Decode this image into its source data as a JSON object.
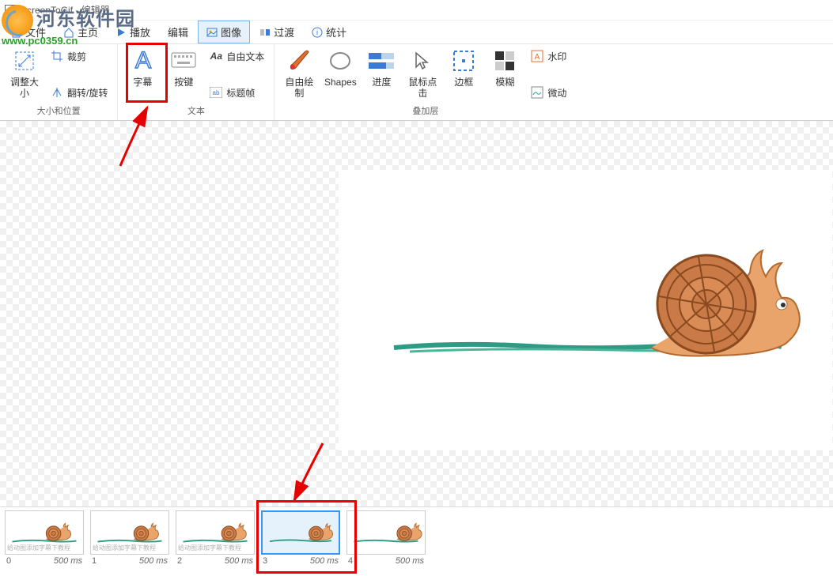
{
  "titlebar": {
    "title": "ScreenToGif - 编辑器"
  },
  "menubar": {
    "file": "文件",
    "home": "主页",
    "playback": "播放",
    "edit": "编辑",
    "image": "图像",
    "transition": "过渡",
    "stats": "统计"
  },
  "ribbon": {
    "groups": {
      "size_pos": {
        "label": "大小和位置",
        "resize": "调整大小",
        "crop": "裁剪",
        "flip_rotate": "翻转/旋转"
      },
      "text": {
        "label": "文本",
        "subtitle": "字幕",
        "keys": "按键",
        "free_text": "自由文本",
        "title_frame": "标题帧"
      },
      "overlay": {
        "label": "叠加层",
        "free_draw": "自由绘制",
        "shapes": "Shapes",
        "progress": "进度",
        "mouse_click": "鼠标点击",
        "border": "边框",
        "blur": "模糊",
        "watermark": "水印",
        "cinemagraph": "微动"
      }
    }
  },
  "frames": [
    {
      "index": 0,
      "duration": "500 ms",
      "watermark_note": "给动图添加字幕下教程"
    },
    {
      "index": 1,
      "duration": "500 ms",
      "watermark_note": "给动图添加字幕下教程"
    },
    {
      "index": 2,
      "duration": "500 ms",
      "watermark_note": "给动图添加字幕下教程"
    },
    {
      "index": 3,
      "duration": "500 ms",
      "selected": true
    },
    {
      "index": 4,
      "duration": "500 ms"
    }
  ],
  "watermark": {
    "text": "河东软件园",
    "url": "www.pc0359.cn"
  }
}
